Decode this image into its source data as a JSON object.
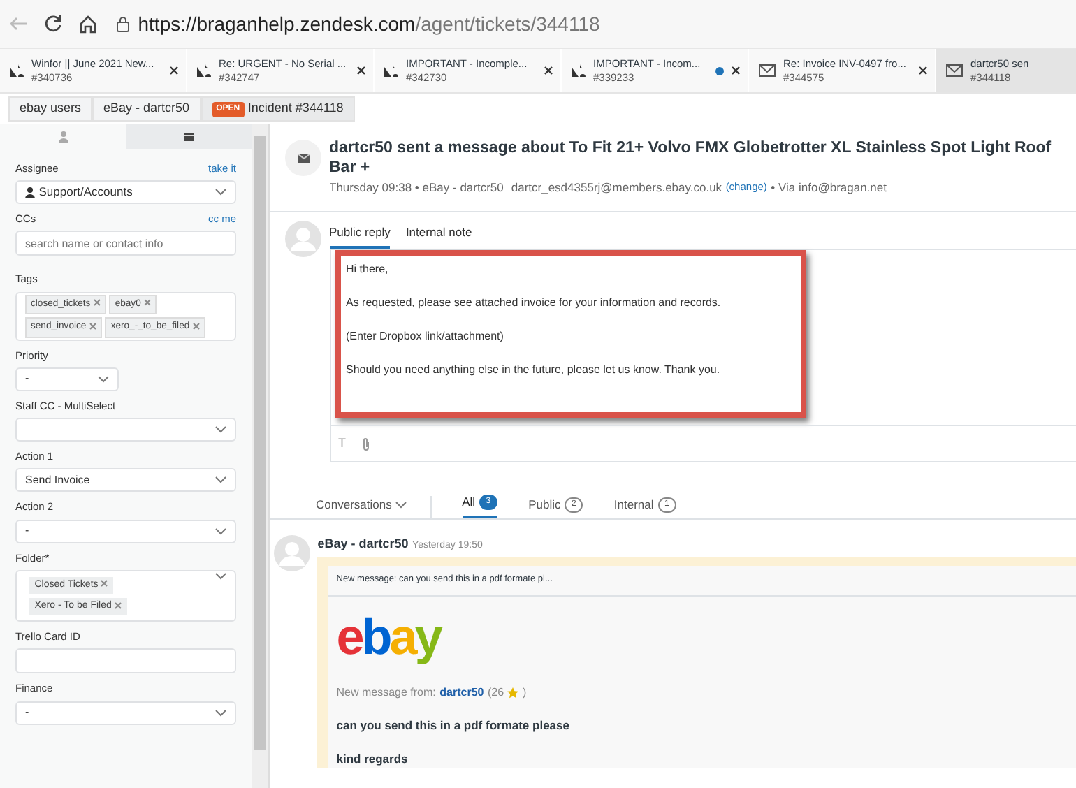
{
  "browser": {
    "url_host": "https://braganhelp.zendesk.com",
    "url_path": "/agent/tickets/344118"
  },
  "ticket_tabs": [
    {
      "kind": "ticket",
      "title": "Winfor || June 2021 New...",
      "number": "#340736",
      "unread": false,
      "selected": false
    },
    {
      "kind": "ticket",
      "title": "Re: URGENT - No Serial ...",
      "number": "#342747",
      "unread": false,
      "selected": false
    },
    {
      "kind": "ticket",
      "title": "IMPORTANT - Incomple...",
      "number": "#342730",
      "unread": false,
      "selected": false
    },
    {
      "kind": "ticket",
      "title": "IMPORTANT - Incom...",
      "number": "#339233",
      "unread": true,
      "selected": false
    },
    {
      "kind": "mail",
      "title": "Re: Invoice INV-0497 fro...",
      "number": "#344575",
      "unread": false,
      "selected": false
    },
    {
      "kind": "mail",
      "title": "dartcr50 sen",
      "number": "#344118",
      "unread": false,
      "selected": true
    }
  ],
  "breadcrumb": [
    {
      "kind": "link",
      "label": "ebay users"
    },
    {
      "kind": "link",
      "label": "eBay - dartcr50"
    },
    {
      "kind": "status",
      "badge": "OPEN",
      "label": "Incident #344118"
    }
  ],
  "sidebar": {
    "tabs": [
      {
        "kind": "user",
        "selected": false
      },
      {
        "kind": "apps",
        "selected": true
      }
    ],
    "fields": [
      {
        "kind": "select",
        "label": "Assignee",
        "link": "take it",
        "value": "Support/Accounts",
        "user_icon": true
      },
      {
        "kind": "input",
        "label": "CCs",
        "link": "cc me",
        "placeholder": "search name or contact info"
      },
      {
        "kind": "tags",
        "label": "Tags",
        "tags": [
          "closed_tickets",
          "ebay0",
          "send_invoice",
          "xero_-_to_be_filed"
        ]
      },
      {
        "kind": "select",
        "label": "Priority",
        "value": "-",
        "narrow": true
      },
      {
        "kind": "select",
        "label": "Staff CC - MultiSelect"
      },
      {
        "kind": "select",
        "label": "Action 1",
        "value": "Send Invoice"
      },
      {
        "kind": "select",
        "label": "Action 2",
        "value": "-"
      },
      {
        "kind": "multiselect",
        "label": "Folder*",
        "tags": [
          "Closed Tickets",
          "Xero - To be Filed"
        ]
      },
      {
        "kind": "input",
        "label": "Trello Card ID"
      },
      {
        "kind": "select",
        "label": "Finance",
        "value": "-"
      }
    ]
  },
  "ticket": {
    "title": "dartcr50 sent a message about To Fit 21+ Volvo FMX Globetrotter XL Stainless Spot Light Roof Bar +",
    "meta": "Thursday 09:38 • eBay - dartcr50",
    "email": "dartcr_esd4355rj@members.ebay.co.uk",
    "change": "(change)",
    "via": "• Via info@bragan.net"
  },
  "composer": {
    "tabs": [
      {
        "label": "Public reply",
        "selected": true
      },
      {
        "label": "Internal note",
        "selected": false
      }
    ],
    "lines": [
      "Hi there,",
      "As requested, please see attached invoice for your information and records.",
      "(Enter Dropbox link/attachment)",
      "Should you need anything else in the future, please let us know. Thank you."
    ],
    "toolbar_text": "T",
    "highlighted": true
  },
  "conversations": {
    "label": "Conversations",
    "filters": [
      {
        "label": "All",
        "count": "3",
        "selected": true
      },
      {
        "label": "Public",
        "count": "2",
        "selected": false
      },
      {
        "label": "Internal",
        "count": "1",
        "selected": false
      }
    ]
  },
  "message": {
    "author": "eBay - dartcr50",
    "time": "Yesterday 19:50",
    "preview": "New message: can you send this in a pdf formate pl...",
    "logo": "ebay",
    "from_label": "New message from:",
    "from_user": "dartcr50",
    "from_score_open": "(26",
    "from_score_close": ")",
    "body": [
      "can you send this in a pdf formate please",
      "kind regards"
    ]
  }
}
